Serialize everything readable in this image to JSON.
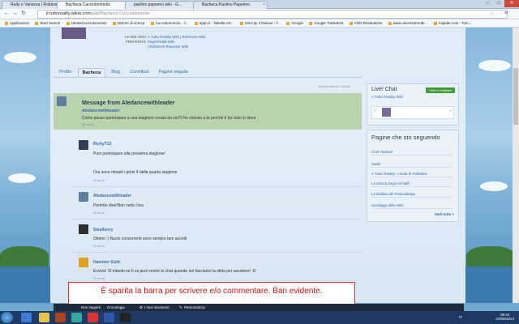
{
  "browser": {
    "tabs": [
      {
        "label": "Rudy e Vanessa | Robinson..."
      },
      {
        "label": "Bacheca:Cucciolorioriolo"
      },
      {
        "label": "paolino paperino wiki - G..."
      },
      {
        "label": "Bacheca:Paolino Paperino"
      }
    ],
    "url_host": "it.tuttoreality.wikia.com",
    "url_path": "/wiki/Bacheca:Cucciolorioriolo",
    "bookmarks": [
      "Applicazioni",
      "Start Search",
      "UtenteCucciolorioriolo",
      "Motore di ricerca",
      "Cucciolorioriolo - Y...",
      "eppo.it - Tabella cer...",
      "SimCity 4 Deluxe - T...",
      "Google",
      "Google Traduttore",
      "AOD Revelations",
      "www.universotombr...",
      "Aspider.com - Tom..."
    ]
  },
  "profile": {
    "favorites_label": "LE MIE WIKI PREFERITE",
    "favorites": [
      "A Tutto Reality Wiki",
      "| Robinson Wiki",
      "PaperPedia Wiki",
      "| Robinson Risposte Wiki"
    ],
    "tabs": [
      "Profilo",
      "Bacheca",
      "Blog",
      "Contributi",
      "Pagine seguite"
    ]
  },
  "wall": {
    "sort_label": "Visualizzati più recenti",
    "title": "Message from Aledancewithleader",
    "author": "Aledancewithleader",
    "text": "Come posso partecipare a una stagione creata da voi?L'ho chiesto a te perchè ti ho visto in linea",
    "time": "15 ore fa",
    "replies": [
      {
        "user": "RichyT12",
        "text1": "Puoi partecipare alla prossima stagione!",
        "text2": "Ora sono rimasti i primi 4 della quarta stagione",
        "time": "15 ore fa"
      },
      {
        "user": "Aledancewithleader",
        "text1": "Perfetto direi!Non vedo l'ora",
        "time": "15 ore fa"
      },
      {
        "user": "Steelberry",
        "text1": "Ottimo :) Nuovi concorrenti sono sempre ben accetti",
        "time": "15 ore fa"
      },
      {
        "user": "Hammer Gold",
        "text1": "Evviva! :D intanto se ti va puoi venire in chat quando noi facciamo la sfida per assistere! :D",
        "time": "15 ore fa"
      }
    ]
  },
  "chat": {
    "title": "Live! Chat",
    "button": "Vieni a chattare",
    "subtitle": "A Tutto Reality Wiki"
  },
  "follow": {
    "title": "Pagine che sto seguendo",
    "items": [
      "Chef Hatchet",
      "Sadie",
      "A Tutto Reality: L'Isola di Pahkitew",
      "La Danza Degli Schiaffi",
      "La Ballata del Festivalanga",
      "Sondaggi della Wiki"
    ],
    "more": "Vedi tutte >"
  },
  "annotation": "È sparita la barra per scrivere e/o commentare. Ban evidente.",
  "toolbar": {
    "items": [
      "Non seguire",
      "Cronologia",
      "I miei strumenti",
      "Personalizza"
    ]
  },
  "taskbar": {
    "lang": "IT",
    "time": "08:44",
    "date": "22/05/2014"
  }
}
